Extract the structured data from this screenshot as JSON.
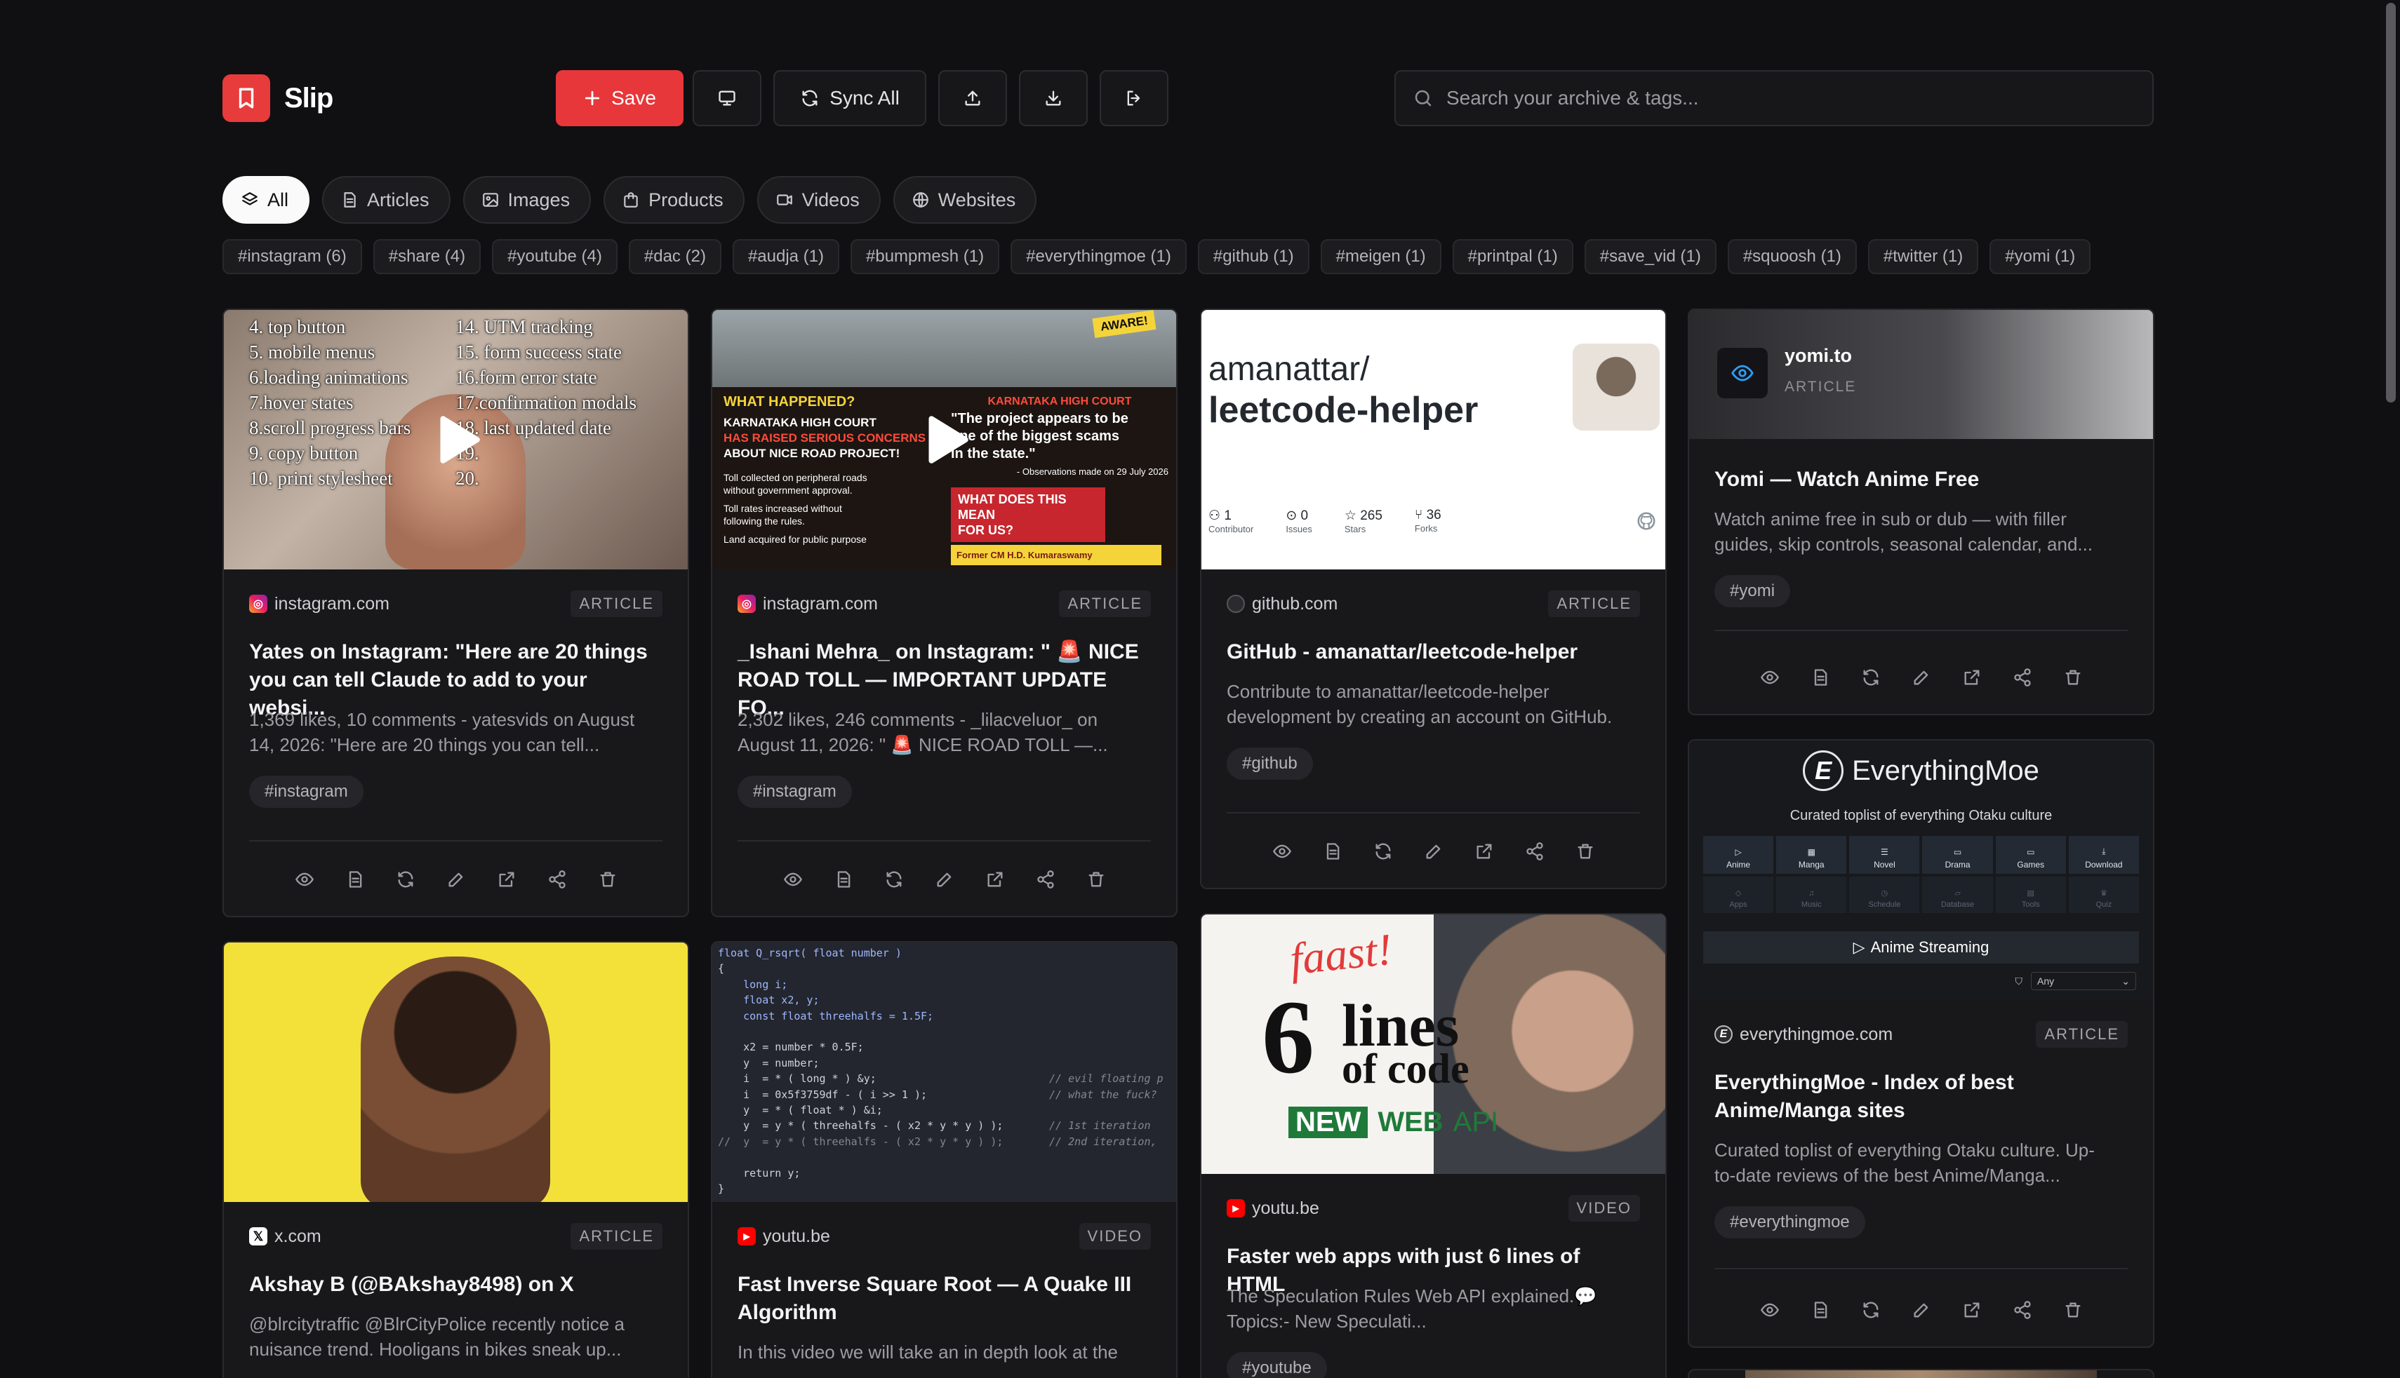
{
  "app": {
    "name": "Slip"
  },
  "toolbar": {
    "save_label": "Save",
    "sync_label": "Sync All",
    "search_placeholder": "Search your archive & tags..."
  },
  "types": [
    {
      "label": "All",
      "icon": "layers-icon",
      "active": true
    },
    {
      "label": "Articles",
      "icon": "document-icon"
    },
    {
      "label": "Images",
      "icon": "image-icon"
    },
    {
      "label": "Products",
      "icon": "shopping-bag-icon"
    },
    {
      "label": "Videos",
      "icon": "video-icon"
    },
    {
      "label": "Websites",
      "icon": "globe-icon"
    }
  ],
  "tags": [
    "#instagram (6)",
    "#share (4)",
    "#youtube (4)",
    "#dac (2)",
    "#audja (1)",
    "#bumpmesh (1)",
    "#everythingmoe (1)",
    "#github (1)",
    "#meigen (1)",
    "#printpal (1)",
    "#save_vid (1)",
    "#squoosh (1)",
    "#twitter (1)",
    "#yomi (1)"
  ],
  "cards": [
    {
      "domain": "instagram.com",
      "kind": "ARTICLE",
      "title_1": "Yates on Instagram: \"Here are 20 things",
      "title_2": "you can tell Claude to add to your websi...",
      "desc_1": "1,369 likes, 10 comments - yatesvids on August",
      "desc_2": "14, 2026: \"Here are 20 things you can tell...",
      "tag": "#instagram",
      "thumb_lines_left": [
        "4. top button",
        "5. mobile menus",
        "6.loading animations",
        "7.hover states",
        "8.scroll progress bars",
        "9. copy button",
        "10. print stylesheet"
      ],
      "thumb_lines_right": [
        "14. UTM tracking",
        "15. form success state",
        "16.form error state",
        "17.confirmation modals",
        "18. last updated date",
        "19.",
        "20."
      ]
    },
    {
      "domain": "instagram.com",
      "kind": "ARTICLE",
      "title_1": "_Ishani Mehra_ on Instagram: \" 🚨 NICE",
      "title_2": "ROAD TOLL — IMPORTANT UPDATE FO...",
      "desc_1": "2,302 likes, 246 comments - _lilacveluor_ on",
      "desc_2": "August 11, 2026: \" 🚨 NICE ROAD TOLL —...",
      "tag": "#instagram",
      "thumb": {
        "badge": "AWARE!",
        "q1": "WHAT HAPPENED?",
        "head": "KARNATAKA HIGH COURT",
        "red1": "HAS RAISED SERIOUS CONCERNS",
        "sub": "ABOUT NICE ROAD PROJECT!",
        "b1a": "Toll collected on peripheral roads",
        "b1b": "without government approval.",
        "b2a": "Toll rates increased without",
        "b2b": "following the rules.",
        "b3": "Land acquired for public purpose",
        "r_head": "KARNATAKA HIGH COURT",
        "quote1": "\"The project appears to be",
        "quote2": "one of the biggest scams",
        "quote3": "in the state.\"",
        "obs": "- Observations made on 29 July 2026",
        "q2a": "WHAT DOES THIS MEAN",
        "q2b": "FOR US?",
        "credit": "Former CM H.D. Kumaraswamy"
      }
    },
    {
      "domain": "github.com",
      "kind": "ARTICLE",
      "title_1": "GitHub - amanattar/leetcode-helper",
      "desc_1": "Contribute to amanattar/leetcode-helper",
      "desc_2": "development by creating an account on GitHub.",
      "tag": "#github",
      "thumb": {
        "owner": "amanattar/",
        "repo": "leetcode-helper",
        "stats": [
          {
            "value": "1",
            "label": "Contributor"
          },
          {
            "value": "0",
            "label": "Issues"
          },
          {
            "value": "265",
            "label": "Stars"
          },
          {
            "value": "36",
            "label": "Forks"
          }
        ]
      }
    },
    {
      "domain": "x.com",
      "kind": "ARTICLE",
      "title_1": "Akshay B (@BAkshay8498) on X",
      "desc_1": "@blrcitytraffic @BlrCityPolice recently notice a",
      "desc_2": "nuisance trend. Hooligans in bikes sneak up..."
    },
    {
      "domain": "youtu.be",
      "kind": "VIDEO",
      "title_1": "Fast Inverse Square Root — A Quake III",
      "title_2": "Algorithm",
      "desc_1": "In this video we will take an in depth look at the",
      "code": [
        "float Q_rsqrt( float number )",
        "{",
        "    long i;",
        "    float x2, y;",
        "    const float threehalfs = 1.5F;",
        "",
        "    x2 = number * 0.5F;",
        "    y  = number;",
        "    i  = * ( long * ) &y;",
        "    i  = 0x5f3759df - ( i >> 1 );",
        "    y  = * ( float * ) &i;",
        "    y  = y * ( threehalfs - ( x2 * y * y ) );",
        "//  y  = y * ( threehalfs - ( x2 * y * y ) );",
        "",
        "    return y;",
        "}"
      ],
      "comments": [
        {
          "line": 8,
          "text": "// evil floating p"
        },
        {
          "line": 9,
          "text": "// what the fuck?"
        },
        {
          "line": 11,
          "text": "// 1st iteration"
        },
        {
          "line": 12,
          "text": "// 2nd iteration,"
        }
      ]
    },
    {
      "domain": "youtu.be",
      "kind": "VIDEO",
      "title_1": "Faster web apps with just 6 lines of HTML",
      "desc_1": "The Speculation Rules Web API explained.💬",
      "desc_2": "Topics:- New Speculati...",
      "tag": "#youtube",
      "thumb": {
        "faast": "faast!",
        "num": "6",
        "lines": "lines",
        "of_code": "of code",
        "new": "NEW",
        "web": "WEB",
        "api": "API"
      }
    },
    {
      "domain": "yomi.to",
      "kind": "ARTICLE",
      "title_1": "Yomi — Watch Anime Free",
      "desc_1": "Watch anime free in sub or dub — with filler",
      "desc_2": "guides, skip controls, seasonal calendar, and...",
      "tag": "#yomi"
    },
    {
      "domain": "everythingmoe.com",
      "kind": "ARTICLE",
      "title_1": "EverythingMoe - Index of best",
      "title_2": "Anime/Manga sites",
      "desc_1": "Curated toplist of everything Otaku culture. Up-",
      "desc_2": "to-date reviews of the best Anime/Manga...",
      "tag": "#everythingmoe",
      "thumb": {
        "name": "EverythingMoe",
        "tagline": "Curated toplist of everything Otaku culture",
        "row1": [
          "Anime",
          "Manga",
          "Novel",
          "Drama",
          "Games",
          "Download"
        ],
        "row2": [
          "Apps",
          "Music",
          "Schedule",
          "Database",
          "Tools",
          "Quiz"
        ],
        "section": "Anime Streaming",
        "filter": "Any"
      }
    }
  ]
}
